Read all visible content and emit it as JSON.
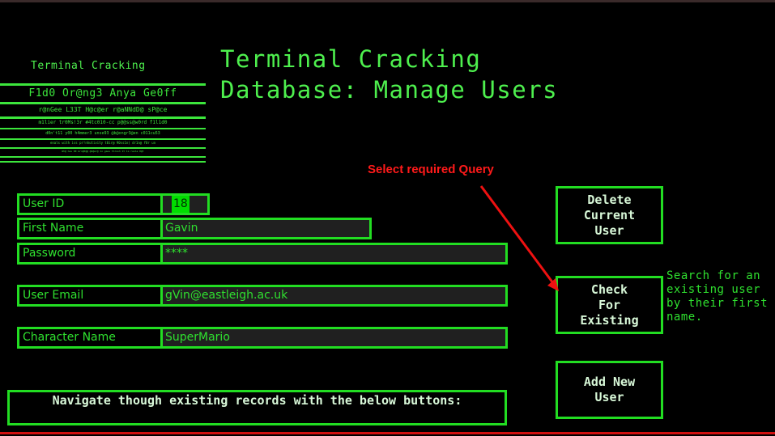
{
  "logo": {
    "title": "Terminal Cracking",
    "line1": "F1d0 Or@ng3 Anya Ge0ff",
    "line2": "r@nGee L33T H@c@er r@aNNdD@ sP@ce",
    "line3": "m1lier tr0Ms!3r #4tc010-cc p@@ss@w0rd f1l1d0",
    "line4": "d0n't11 y00 h4mmer3 unse93 @b@ongr3@en c011cu53",
    "line5": "enals with iss pr!nhutivity t0ir@ 90ss1n) dr1n@ f0r un",
    "line6": "Wh@ has 00 mrn@0@@ @m@er@ 1o gaes thrush 1t 1s reola 0@t"
  },
  "page": {
    "title": "Terminal Cracking Database: Manage Users"
  },
  "form": {
    "user_id_label": "User ID",
    "user_id_value": "18",
    "first_name_label": "First Name",
    "first_name_value": "Gavin",
    "password_label": "Password",
    "password_value": "****",
    "email_label": "User Email",
    "email_value": "gVin@eastleigh.ac.uk",
    "character_label": "Character Name",
    "character_value": "SuperMario"
  },
  "buttons": {
    "delete": "Delete\nCurrent\nUser",
    "check": "Check\nFor\nExisting",
    "add": "Add New\nUser"
  },
  "search_note": "Search for an existing user by their first name.",
  "annotation": "Select required Query",
  "nav_text": "Navigate though existing records with the below buttons:",
  "colors": {
    "accent": "#22dd22",
    "annotation": "#ff1a1a",
    "background": "#000000"
  }
}
